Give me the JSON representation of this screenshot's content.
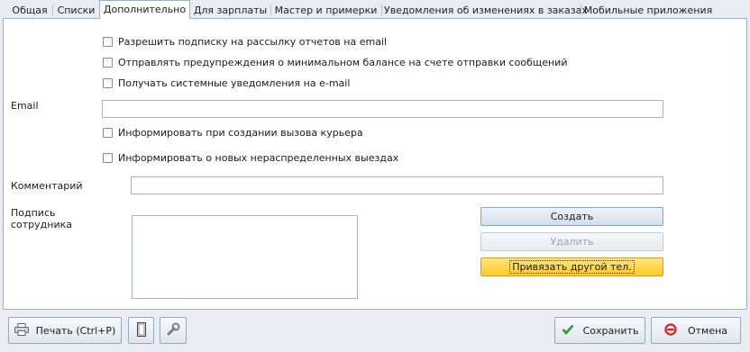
{
  "tabs": [
    {
      "label": "Общая"
    },
    {
      "label": "Списки"
    },
    {
      "label": "Дополнительно"
    },
    {
      "label": "Для зарплаты"
    },
    {
      "label": "Мастер и примерки"
    },
    {
      "label": "Уведомления об изменениях в заказах"
    },
    {
      "label": "Мобильные приложения"
    }
  ],
  "active_tab": "Дополнительно",
  "checkboxes": {
    "subscribe_reports": {
      "label": "Разрешить подписку на рассылку отчетов на email",
      "checked": false
    },
    "min_balance_warning": {
      "label": "Отправлять предупреждения о минимальном балансе на счете отправки сообщений",
      "checked": false
    },
    "system_notifications": {
      "label": "Получать системные уведомления на e-mail",
      "checked": false
    },
    "courier_call_info": {
      "label": "Информировать при создании вызова курьера",
      "checked": false
    },
    "unassigned_trips_info": {
      "label": "Информировать о новых нераспределенных выездах",
      "checked": false
    }
  },
  "fields": {
    "email": {
      "label": "Email",
      "value": ""
    },
    "comment": {
      "label": "Комментарий",
      "value": ""
    },
    "signature": {
      "label_line1": "Подпись",
      "label_line2": "сотрудника"
    }
  },
  "signature_buttons": {
    "create": "Создать",
    "delete": "Удалить",
    "bind_phone": "Привязать другой тел."
  },
  "footer": {
    "print": "Печать (Ctrl+P)",
    "save": "Сохранить",
    "cancel": "Отмена"
  },
  "icons": {
    "print": "printer-icon",
    "page": "page-icon",
    "wrench": "wrench-icon",
    "save": "checkmark-icon",
    "cancel": "no-entry-icon"
  },
  "colors": {
    "accent_yellow": "#ffc928",
    "save_check": "#2e9b34",
    "cancel_red": "#d62020"
  }
}
